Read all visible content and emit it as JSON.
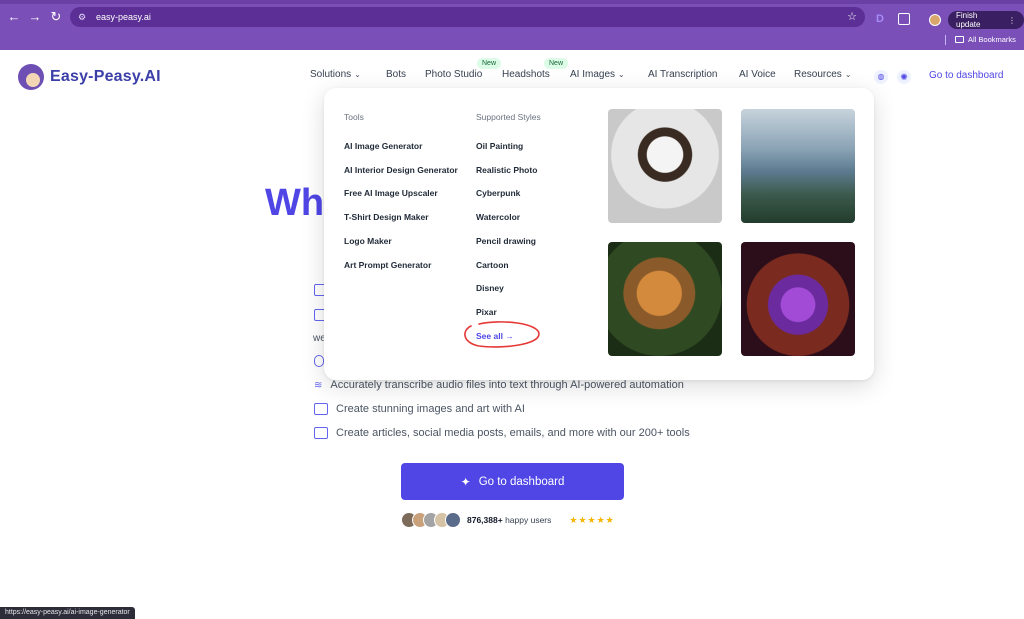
{
  "browser": {
    "url": "easy-peasy.ai",
    "finish_update": "Finish update",
    "all_bookmarks": "All Bookmarks",
    "extension_letter": "D",
    "status_url": "https://easy-peasy.ai/ai-image-generator"
  },
  "site": {
    "logo_text": "Easy-Peasy.AI",
    "nav": {
      "solutions": "Solutions",
      "bots": "Bots",
      "photo_studio": "Photo Studio",
      "headshots": "Headshots",
      "ai_images": "AI Images",
      "ai_transcription": "AI Transcription",
      "ai_voice": "AI Voice",
      "resources": "Resources",
      "go_to_dashboard": "Go to dashboard",
      "badge_new": "New"
    }
  },
  "dropdown": {
    "tools_heading": "Tools",
    "tools": [
      "AI Image Generator",
      "AI Interior Design Generator",
      "Free AI Image Upscaler",
      "T-Shirt Design Maker",
      "Logo Maker",
      "Art Prompt Generator"
    ],
    "styles_heading": "Supported Styles",
    "styles": [
      "Oil Painting",
      "Realistic Photo",
      "Cyberpunk",
      "Watercolor",
      "Pencil drawing",
      "Cartoon",
      "Disney",
      "Pixar"
    ],
    "see_all": "See all →"
  },
  "hero": {
    "title_fragment": "Wh",
    "fragment_we": "we",
    "lines": [
      "Accurately transcribe audio files into text through AI-powered automation",
      "Create stunning images and art with AI",
      "Create articles, social media posts, emails, and more with our 200+ tools"
    ],
    "cta": "Go to dashboard",
    "users_count": "876,388+",
    "users_suffix": "happy users",
    "stars": "★★★★★"
  },
  "colors": {
    "accent": "#4f46e5",
    "chrome": "#7a4fb8",
    "badge_bg": "#dcfce7",
    "circle_annotation": "#e53935"
  }
}
